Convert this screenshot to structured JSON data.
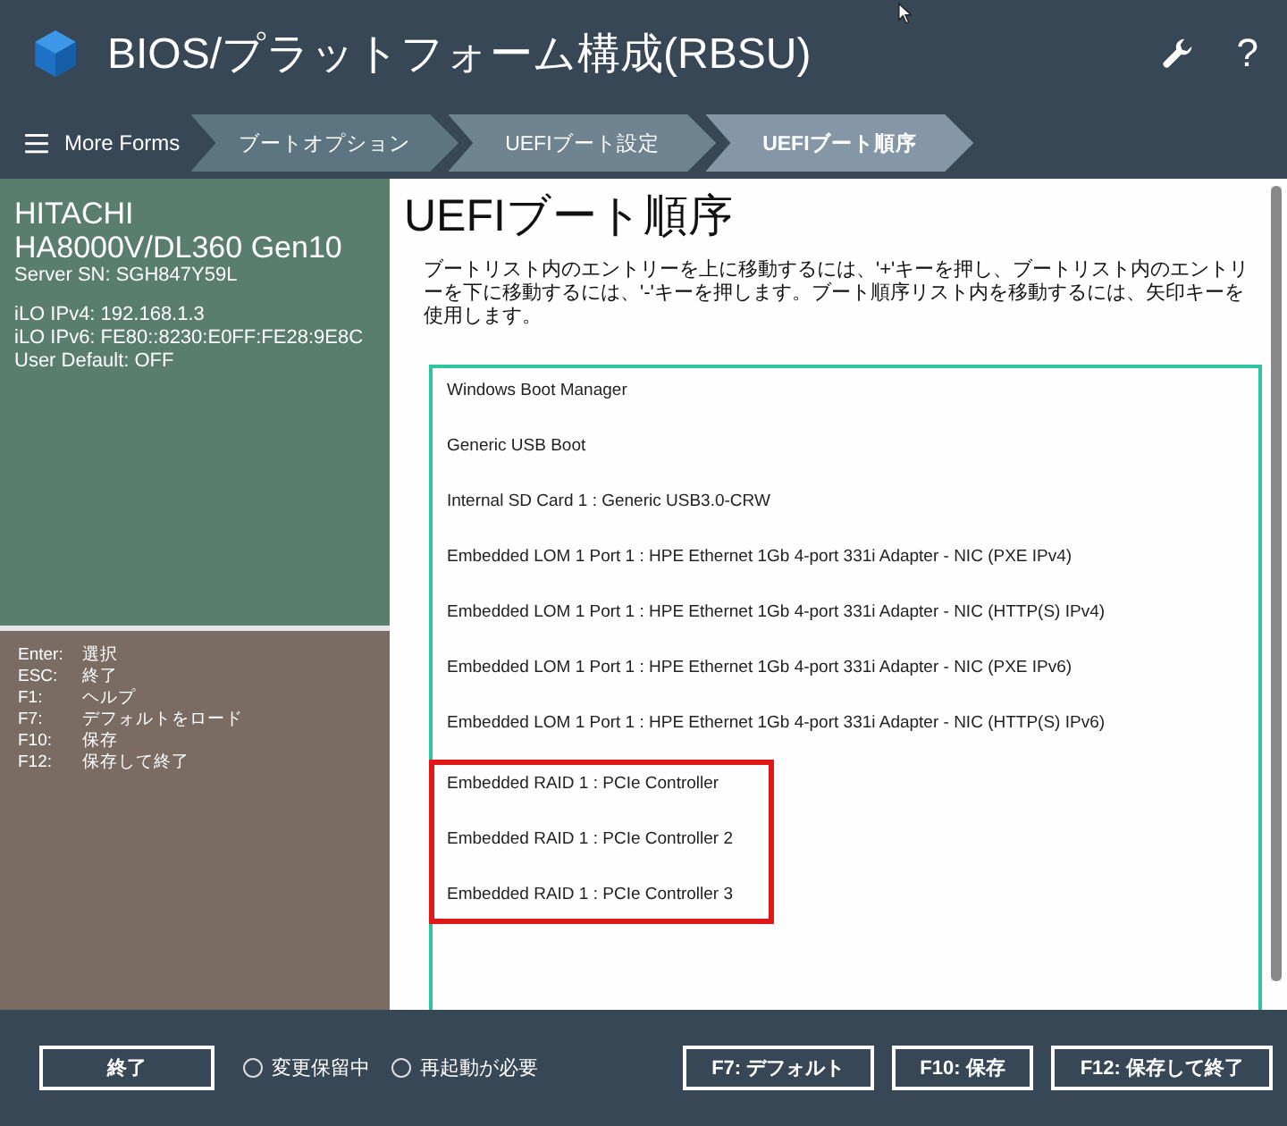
{
  "header": {
    "title": "BIOS/プラットフォーム構成(RBSU)",
    "help_glyph": "?"
  },
  "breadcrumb": {
    "menu_label": "More Forms",
    "items": [
      {
        "label": "ブートオプション",
        "selected": false
      },
      {
        "label": "UEFIブート設定",
        "selected": false
      },
      {
        "label": "UEFIブート順序",
        "selected": true
      }
    ]
  },
  "system_info": {
    "vendor": "HITACHI",
    "model": "HA8000V/DL360 Gen10",
    "serial": "Server SN: SGH847Y59L",
    "lines": [
      "iLO IPv4: 192.168.1.3",
      "iLO IPv6: FE80::8230:E0FF:FE28:9E8C",
      "User Default: OFF"
    ]
  },
  "key_help": [
    {
      "key": "Enter:",
      "action": "選択"
    },
    {
      "key": "ESC:",
      "action": "終了"
    },
    {
      "key": "F1:",
      "action": "ヘルプ"
    },
    {
      "key": "F7:",
      "action": "デフォルトをロード"
    },
    {
      "key": "F10:",
      "action": "保存"
    },
    {
      "key": "F12:",
      "action": "保存して終了"
    }
  ],
  "page": {
    "title": "UEFIブート順序",
    "description": "ブートリスト内のエントリーを上に移動するには、'+'キーを押し、ブートリスト内のエントリーを下に移動するには、'-'キーを押します。ブート順序リスト内を移動するには、矢印キーを使用します。"
  },
  "boot_entries": [
    {
      "label": "Windows Boot Manager",
      "highlighted": false
    },
    {
      "label": "Generic USB Boot",
      "highlighted": false
    },
    {
      "label": "Internal SD Card 1 : Generic USB3.0-CRW",
      "highlighted": false
    },
    {
      "label": "Embedded LOM 1 Port 1 : HPE Ethernet 1Gb 4-port 331i Adapter - NIC (PXE IPv4)",
      "highlighted": false
    },
    {
      "label": "Embedded LOM 1 Port 1 : HPE Ethernet 1Gb 4-port 331i Adapter - NIC (HTTP(S) IPv4)",
      "highlighted": false
    },
    {
      "label": "Embedded LOM 1 Port 1 : HPE Ethernet 1Gb 4-port 331i Adapter - NIC (PXE IPv6)",
      "highlighted": false
    },
    {
      "label": "Embedded LOM 1 Port 1 : HPE Ethernet 1Gb 4-port 331i Adapter - NIC (HTTP(S) IPv6)",
      "highlighted": false
    },
    {
      "label": "Embedded RAID 1 : PCIe Controller",
      "highlighted": true
    },
    {
      "label": "Embedded RAID 1 : PCIe Controller 2",
      "highlighted": true
    },
    {
      "label": "Embedded RAID 1 : PCIe Controller 3",
      "highlighted": true
    }
  ],
  "footer": {
    "exit_button": "終了",
    "indicators": [
      {
        "label": "変更保留中",
        "on": false
      },
      {
        "label": "再起動が必要",
        "on": false
      }
    ],
    "buttons": [
      "F7: デフォルト",
      "F10: 保存",
      "F12: 保存して終了"
    ]
  }
}
